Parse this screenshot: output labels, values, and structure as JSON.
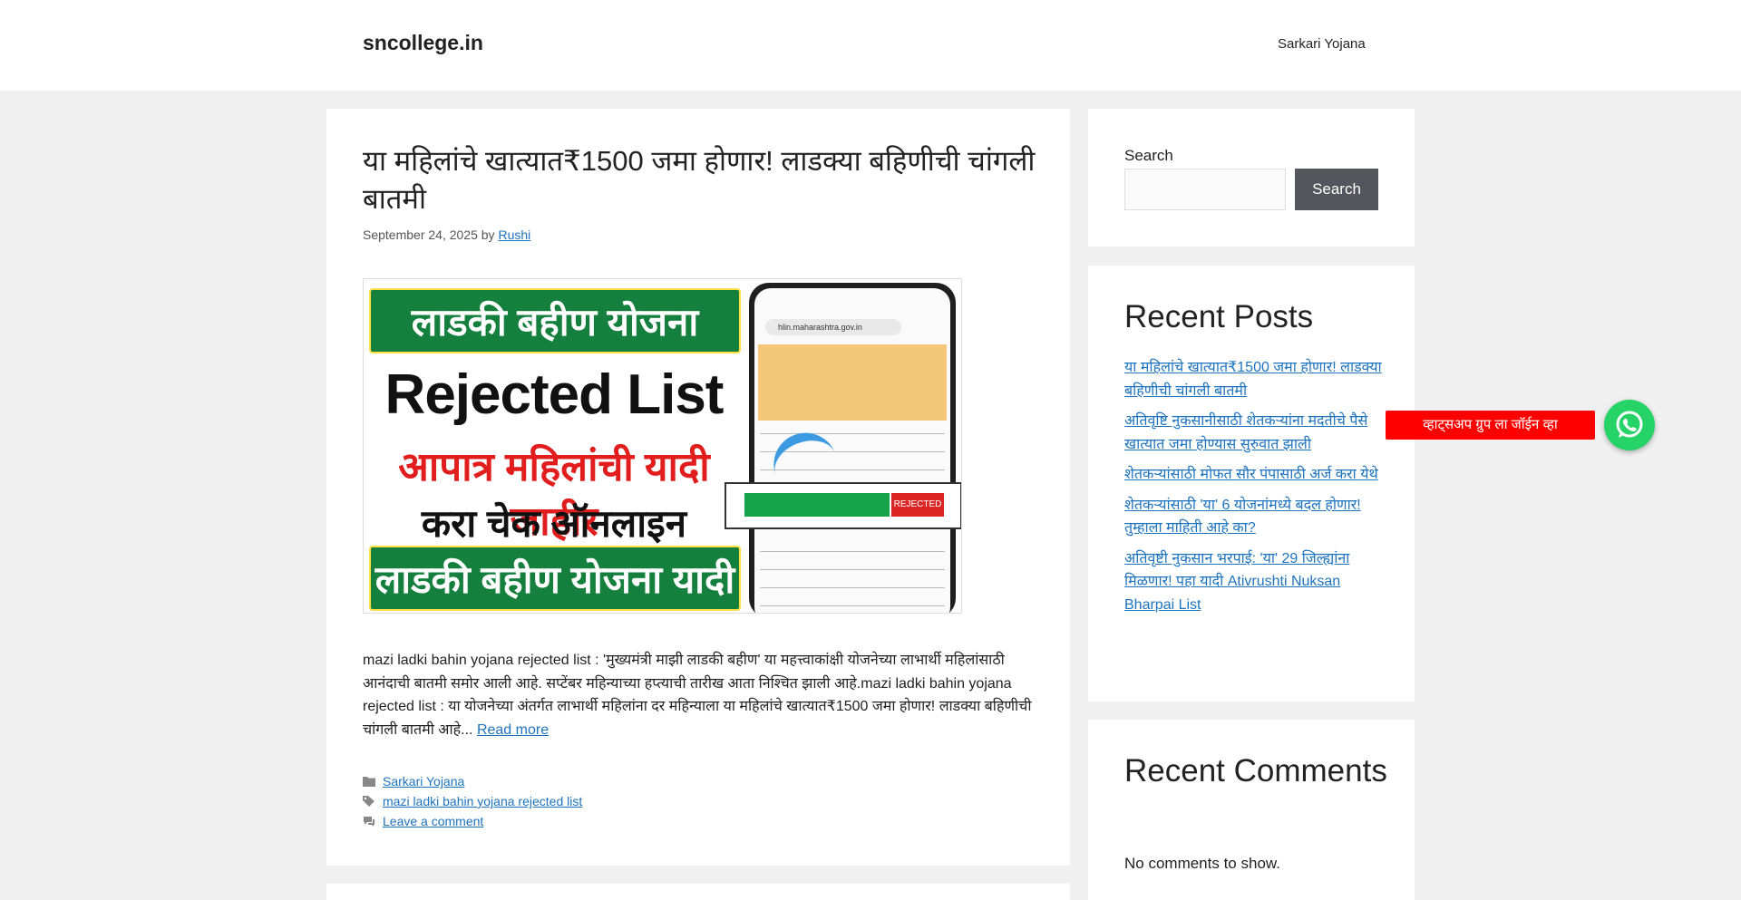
{
  "header": {
    "site_title": "sncollege.in",
    "nav_item": "Sarkari Yojana"
  },
  "article": {
    "title": "या महिलांचे खात्यात₹1500 जमा होणार! लाडक्या बहिणीची चांगली बातमी",
    "date": "September 24, 2025",
    "by": "by",
    "author": "Rushi",
    "image": {
      "band_top": "लाडकी बहीण योजना",
      "rejected": "Rejected List",
      "red_line": "आपात्र महिलांची यादी जाहीर",
      "black_line": "करा चेक ऑनलाइन",
      "band_bottom": "लाडकी बहीण योजना यादी",
      "phone_url": "hlin.maharashtra.gov.in",
      "rejected_tag": "REJECTED"
    },
    "excerpt": "mazi ladki bahin yojana rejected list : 'मुख्यमंत्री माझी लाडकी बहीण' या महत्त्वाकांक्षी योजनेच्या लाभार्थी महिलांसाठी आनंदाची बातमी समोर आली आहे. सप्टेंबर महिन्याच्या हप्त्याची तारीख आता निश्चित झाली आहे.mazi ladki bahin yojana rejected list : या योजनेच्या अंतर्गत लाभार्थी महिलांना दर महिन्याला  या महिलांचे खात्यात₹1500 जमा होणार! लाडक्या बहिणीची चांगली बातमी आहे...",
    "read_more": "Read more",
    "category": "Sarkari Yojana",
    "tag": "mazi ladki bahin yojana rejected list",
    "comment_link": "Leave a comment"
  },
  "sidebar": {
    "search_label": "Search",
    "search_value": "",
    "search_button": "Search",
    "recent_posts_heading": "Recent Posts",
    "recent_posts": [
      "या महिलांचे खात्यात₹1500 जमा होणार! लाडक्या बहिणीची चांगली बातमी",
      "अतिवृष्टि नुकसानीसाठी शेतकऱ्यांना मदतीचे पैसे खात्यात जमा होण्यास सुरुवात झाली",
      "शेतकऱ्यांसाठी मोफत सौर पंपासाठी अर्ज करा येथे",
      "शेतकऱ्यांसाठी 'या' 6 योजनांमध्ये बदल होणार! तुम्हाला माहिती आहे का?",
      "अतिवृष्टी नुकसान भरपाई: 'या' 29 जिल्ह्यांना मिळणार! पहा यादी Ativrushti Nuksan Bharpai List"
    ],
    "recent_comments_heading": "Recent Comments",
    "no_comments": "No comments to show."
  },
  "whatsapp": {
    "label": "व्हाट्सअप ग्रुप ला जॉईन व्हा",
    "icon": "whatsapp-icon",
    "color": "#25d366",
    "label_color": "#ff0000"
  },
  "colors": {
    "link": "#1e73be",
    "search_button": "#55555e",
    "page_bg": "#f0f0f0"
  }
}
